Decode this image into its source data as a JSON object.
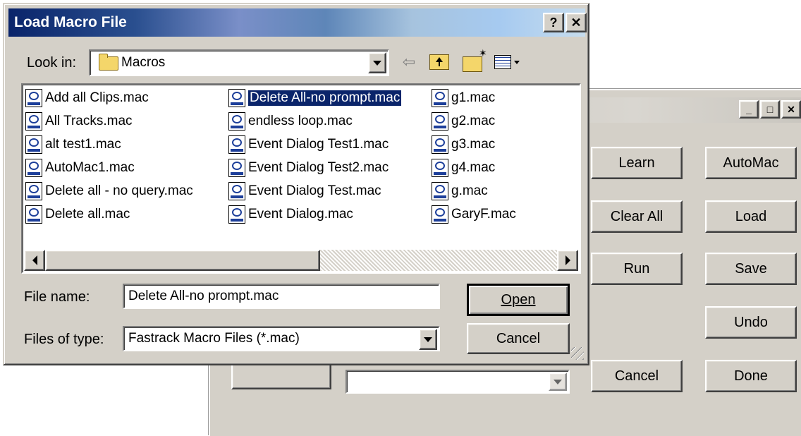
{
  "dialog": {
    "title": "Load Macro File",
    "help_label": "?",
    "close_label": "✕",
    "look_in_label": "Look in:",
    "look_in_value": "Macros",
    "toolbar": {
      "back_icon": "⇦",
      "up_folder_icon": "up-folder-icon",
      "new_folder_icon": "new-folder-icon",
      "view_menu_icon": "view-menu-icon"
    },
    "files": {
      "col1": [
        "Add all Clips.mac",
        "All Tracks.mac",
        "alt test1.mac",
        "AutoMac1.mac",
        "Delete all - no query.mac",
        "Delete all.mac"
      ],
      "col2": [
        "Delete All-no prompt.mac",
        "endless loop.mac",
        "Event Dialog Test1.mac",
        "Event Dialog Test2.mac",
        "Event Dialog Test.mac",
        "Event Dialog.mac"
      ],
      "col3": [
        "g1.mac",
        "g2.mac",
        "g3.mac",
        "g4.mac",
        "g.mac",
        "GaryF.mac"
      ],
      "selected": "Delete All-no prompt.mac"
    },
    "file_name_label": "File name:",
    "file_name_value": "Delete All-no prompt.mac",
    "files_of_type_label": "Files of type:",
    "files_of_type_value": "Fastrack Macro Files (*.mac)",
    "open_label": "Open",
    "cancel_label": "Cancel"
  },
  "background_window": {
    "minimize_label": "_",
    "maximize_label": "□",
    "close_label": "✕",
    "buttons": {
      "learn": "Learn",
      "automac": "AutoMac",
      "clear_all": "Clear All",
      "load": "Load",
      "run": "Run",
      "save": "Save",
      "undo": "Undo",
      "cancel": "Cancel",
      "done": "Done"
    }
  },
  "colors": {
    "face": "#d4d0c8",
    "selection": "#0a246a",
    "title_start": "#0a246a",
    "title_end": "#a6caf0"
  }
}
